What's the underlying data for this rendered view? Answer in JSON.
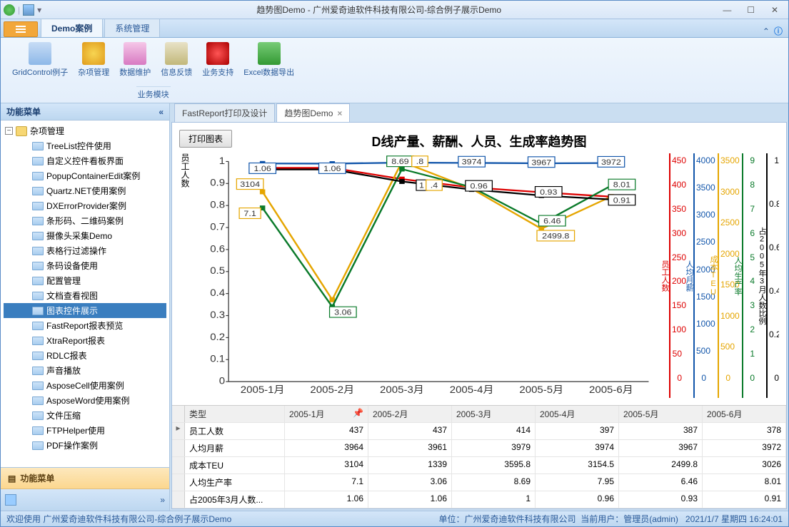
{
  "window": {
    "title": "趋势图Demo - 广州爱奇迪软件科技有限公司-综合例子展示Demo"
  },
  "ribbon_tabs": {
    "demo": "Demo案例",
    "system": "系统管理"
  },
  "ribbon": {
    "items": [
      {
        "label": "GridControl例子"
      },
      {
        "label": "杂项管理"
      },
      {
        "label": "数据维护"
      },
      {
        "label": "信息反馈"
      },
      {
        "label": "业务支持"
      },
      {
        "label": "Excel数据导出"
      }
    ],
    "group_title": "业务模块"
  },
  "sidebar": {
    "title": "功能菜单",
    "footer_title": "功能菜单",
    "root": "杂项管理",
    "items": [
      "TreeList控件使用",
      "自定义控件看板界面",
      "PopupContainerEdit案例",
      "Quartz.NET使用案例",
      "DXErrorProvider案例",
      "条形码、二维码案例",
      "摄像头采集Demo",
      "表格行过滤操作",
      "条码设备使用",
      "配置管理",
      "文档查看视图",
      "图表控件展示",
      "FastReport报表预览",
      "XtraReport报表",
      "RDLC报表",
      "声音播放",
      "AsposeCell使用案例",
      "AsposeWord使用案例",
      "文件压缩",
      "FTPHelper使用",
      "PDF操作案例"
    ],
    "selected_index": 11
  },
  "doc_tabs": {
    "t1": "FastReport打印及设计",
    "t2": "趋势图Demo"
  },
  "chart": {
    "print_btn": "打印图表",
    "title": "D线产量、薪酬、人员、生成率趋势图",
    "ylabel": "员工人数",
    "categories": [
      "2005-1月",
      "2005-2月",
      "2005-3月",
      "2005-4月",
      "2005-5月",
      "2005-6月"
    ],
    "right_axes": [
      {
        "label": "员工人数",
        "color": "#d00",
        "ticks": [
          "450",
          "400",
          "350",
          "300",
          "250",
          "200",
          "150",
          "100",
          "50",
          "0"
        ]
      },
      {
        "label": "人均月薪",
        "color": "#15a",
        "ticks": [
          "4000",
          "3500",
          "3000",
          "2500",
          "2000",
          "1500",
          "1000",
          "500",
          "0"
        ]
      },
      {
        "label": "成本TEU",
        "color": "#e5a500",
        "ticks": [
          "3500",
          "3000",
          "2500",
          "2000",
          "1500",
          "1000",
          "500",
          "0"
        ]
      },
      {
        "label": "人均生产率",
        "color": "#0a7a2a",
        "ticks": [
          "9",
          "8",
          "7",
          "6",
          "5",
          "4",
          "3",
          "2",
          "1",
          "0"
        ]
      },
      {
        "label": "占2005年3月人数比例",
        "color": "#000",
        "ticks": [
          "1",
          "0.8",
          "0.6",
          "0.4",
          "0.2",
          "0"
        ]
      }
    ],
    "left_ticks": [
      "1",
      "0.9",
      "0.8",
      "0.7",
      "0.6",
      "0.5",
      "0.4",
      "0.3",
      "0.2",
      "0.1",
      "0"
    ]
  },
  "chart_data": {
    "type": "line",
    "categories": [
      "2005-1月",
      "2005-2月",
      "2005-3月",
      "2005-4月",
      "2005-5月",
      "2005-6月"
    ],
    "series": [
      {
        "name": "员工人数",
        "values": [
          437,
          437,
          414,
          397,
          387,
          378
        ],
        "color": "#d00"
      },
      {
        "name": "人均月薪",
        "values": [
          3964,
          3961,
          3979,
          3974,
          3967,
          3972
        ],
        "color": "#15a"
      },
      {
        "name": "成本TEU",
        "values": [
          3104,
          1339,
          3595.8,
          3154.5,
          2499.8,
          3026
        ],
        "color": "#e5a500"
      },
      {
        "name": "人均生产率",
        "values": [
          7.1,
          3.06,
          8.69,
          7.95,
          6.46,
          8.01
        ],
        "color": "#0a7a2a"
      },
      {
        "name": "占2005年3月人数比例",
        "values": [
          1.06,
          1.06,
          1,
          0.96,
          0.93,
          0.91
        ],
        "color": "#000"
      }
    ],
    "data_labels": {
      "blue": [
        "",
        "1.06",
        "1.06",
        "",
        "3974",
        "3967",
        "3972"
      ],
      "green": [
        "",
        "",
        "3.06",
        "8.69",
        "",
        "6.46",
        "8.01"
      ],
      "black": [
        "",
        "",
        "",
        "1.4",
        "0.96",
        "0.93",
        "0.91"
      ],
      "orange": [
        "3104",
        "7.1",
        "",
        "",
        "",
        "2499.8",
        ""
      ]
    }
  },
  "grid": {
    "headers": [
      "类型",
      "2005-1月",
      "2005-2月",
      "2005-3月",
      "2005-4月",
      "2005-5月",
      "2005-6月"
    ],
    "rows": [
      {
        "label": "员工人数",
        "vals": [
          "437",
          "437",
          "414",
          "397",
          "387",
          "378"
        ]
      },
      {
        "label": "人均月薪",
        "vals": [
          "3964",
          "3961",
          "3979",
          "3974",
          "3967",
          "3972"
        ]
      },
      {
        "label": "成本TEU",
        "vals": [
          "3104",
          "1339",
          "3595.8",
          "3154.5",
          "2499.8",
          "3026"
        ]
      },
      {
        "label": "人均生产率",
        "vals": [
          "7.1",
          "3.06",
          "8.69",
          "7.95",
          "6.46",
          "8.01"
        ]
      },
      {
        "label": "占2005年3月人数...",
        "vals": [
          "1.06",
          "1.06",
          "1",
          "0.96",
          "0.93",
          "0.91"
        ]
      }
    ]
  },
  "status": {
    "left": "欢迎使用 广州爱奇迪软件科技有限公司-综合例子展示Demo",
    "company": "单位：广州爱奇迪软件科技有限公司",
    "user": "当前用户：管理员(admin)",
    "time": "2021/1/7 星期四 16:24:01"
  }
}
